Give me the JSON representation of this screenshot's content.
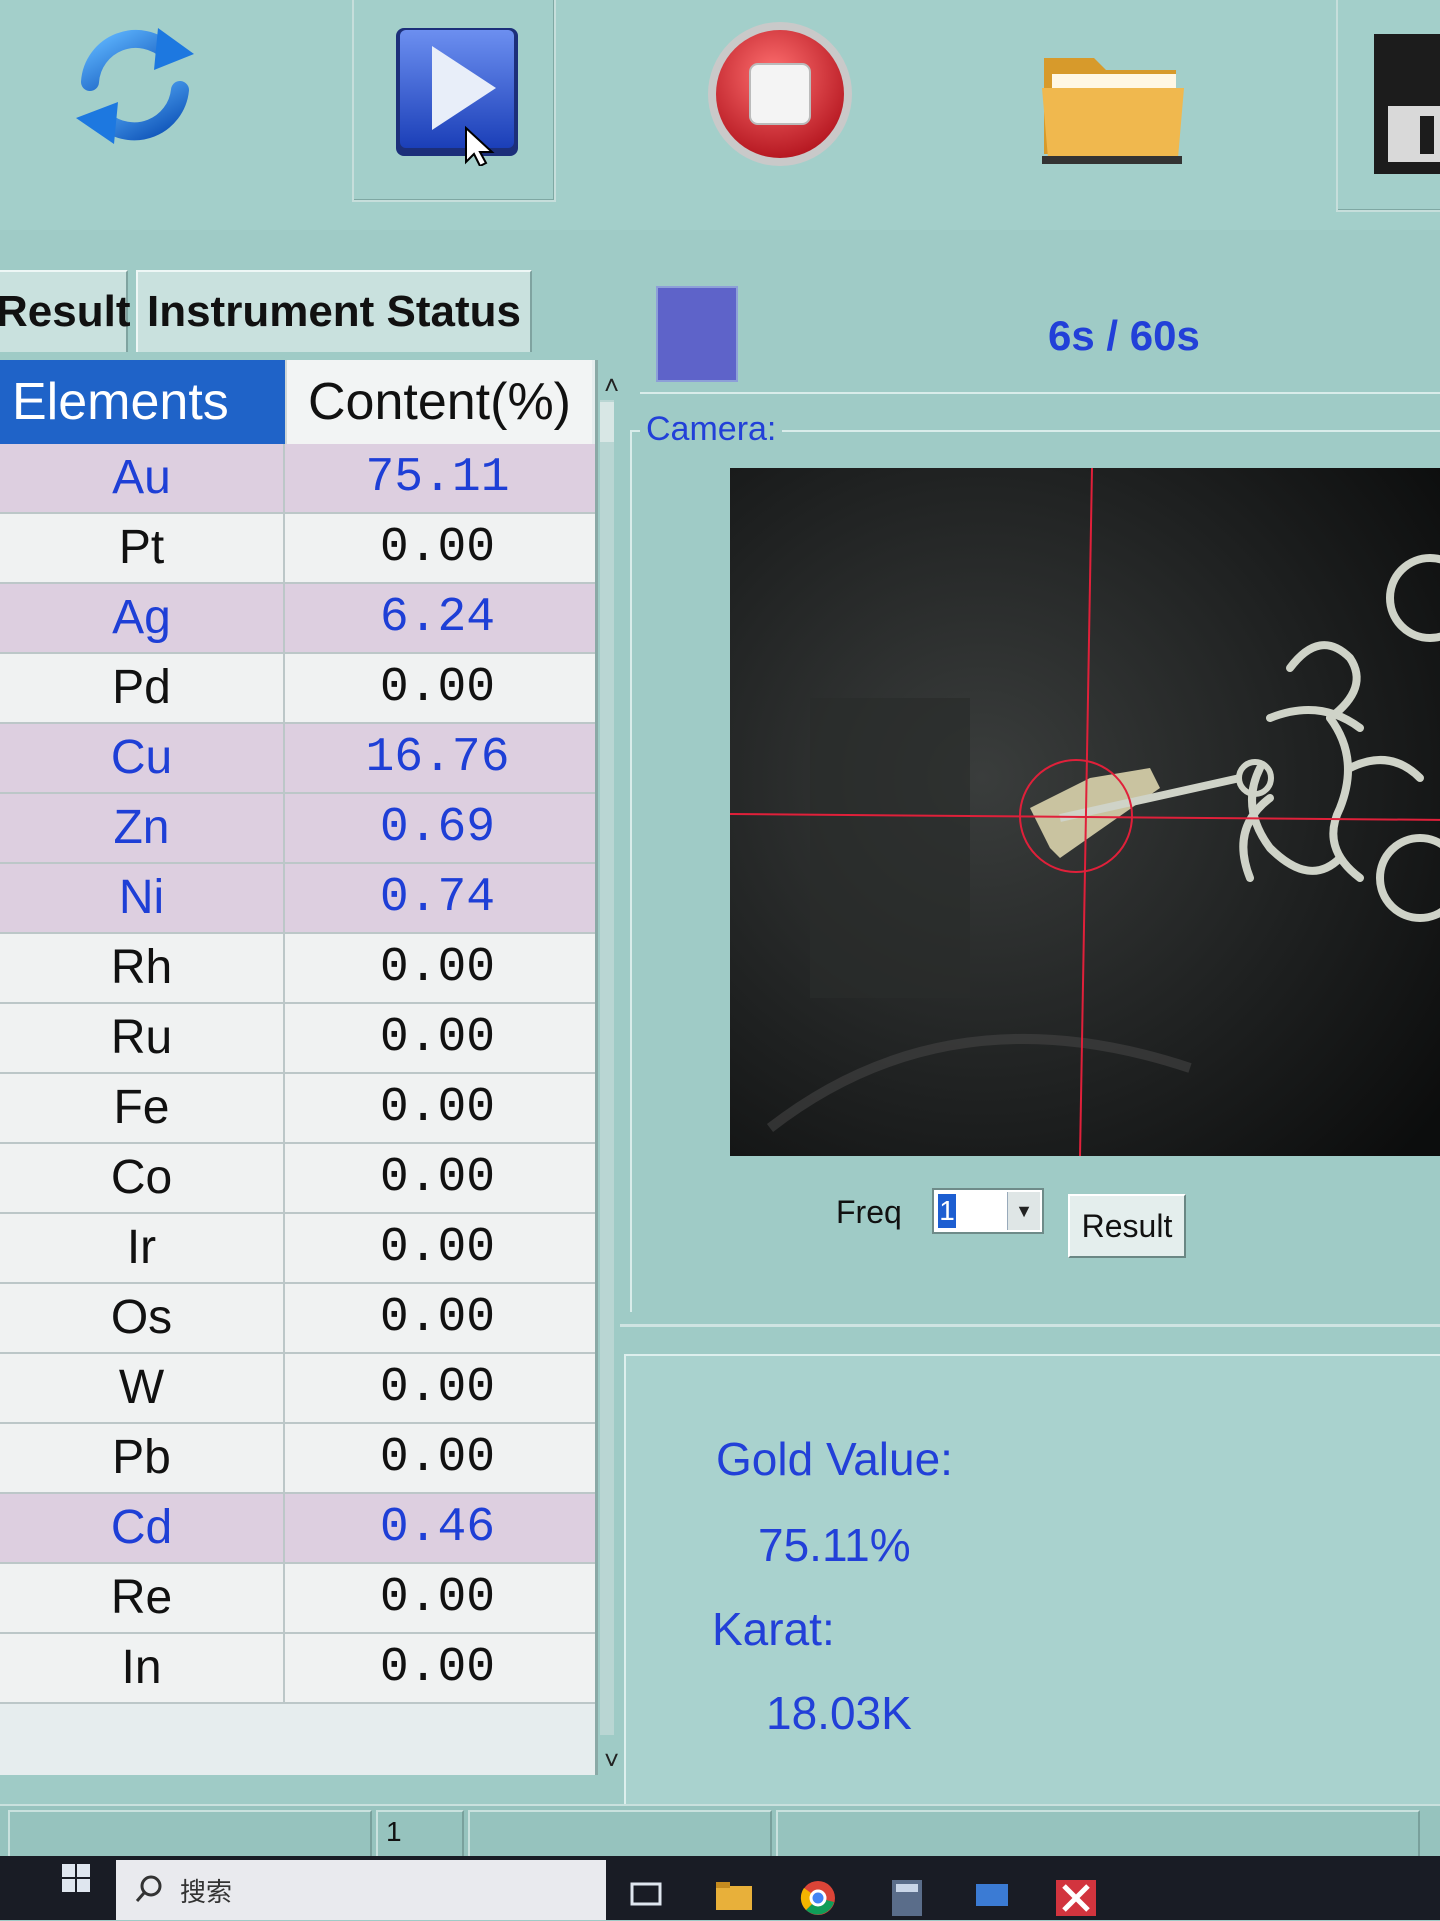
{
  "toolbar": {
    "buttons": [
      {
        "name": "refresh",
        "icon": "refresh-icon"
      },
      {
        "name": "start",
        "icon": "play-icon"
      },
      {
        "name": "stop",
        "icon": "stop-icon"
      },
      {
        "name": "open",
        "icon": "folder-icon"
      },
      {
        "name": "save",
        "icon": "save-icon"
      }
    ]
  },
  "tabs": {
    "result": "Result",
    "instrument_status": "Instrument Status"
  },
  "table": {
    "headers": {
      "element": "Elements",
      "content": "Content(%)"
    },
    "rows": [
      {
        "element": "Au",
        "value": "75.11",
        "highlight": true
      },
      {
        "element": "Pt",
        "value": "0.00",
        "highlight": false
      },
      {
        "element": "Ag",
        "value": "6.24",
        "highlight": true
      },
      {
        "element": "Pd",
        "value": "0.00",
        "highlight": false
      },
      {
        "element": "Cu",
        "value": "16.76",
        "highlight": true
      },
      {
        "element": "Zn",
        "value": "0.69",
        "highlight": true
      },
      {
        "element": "Ni",
        "value": "0.74",
        "highlight": true
      },
      {
        "element": "Rh",
        "value": "0.00",
        "highlight": false
      },
      {
        "element": "Ru",
        "value": "0.00",
        "highlight": false
      },
      {
        "element": "Fe",
        "value": "0.00",
        "highlight": false
      },
      {
        "element": "Co",
        "value": "0.00",
        "highlight": false
      },
      {
        "element": "Ir",
        "value": "0.00",
        "highlight": false
      },
      {
        "element": "Os",
        "value": "0.00",
        "highlight": false
      },
      {
        "element": "W",
        "value": "0.00",
        "highlight": false
      },
      {
        "element": "Pb",
        "value": "0.00",
        "highlight": false
      },
      {
        "element": "Cd",
        "value": "0.46",
        "highlight": true
      },
      {
        "element": "Re",
        "value": "0.00",
        "highlight": false
      },
      {
        "element": "In",
        "value": "0.00",
        "highlight": false
      }
    ]
  },
  "progress": {
    "text": "6s / 60s",
    "elapsed_s": 6,
    "total_s": 60
  },
  "camera": {
    "label": "Camera:"
  },
  "controls": {
    "freq_label": "Freq",
    "freq_value": "1",
    "result_button": "Result"
  },
  "gold": {
    "value_label": "Gold Value:",
    "value": "75.11%",
    "karat_label": "Karat:",
    "karat": "18.03K"
  },
  "status_bar": {
    "page": "1"
  },
  "taskbar": {
    "search_text": "搜索"
  },
  "colors": {
    "background": "#9fcbc6",
    "header_blue": "#1f63c8",
    "highlight_text": "#1e3fd6",
    "highlight_row": "#ddcfe0",
    "progress_fill": "#5e63c9",
    "crosshair": "#e0203a"
  }
}
